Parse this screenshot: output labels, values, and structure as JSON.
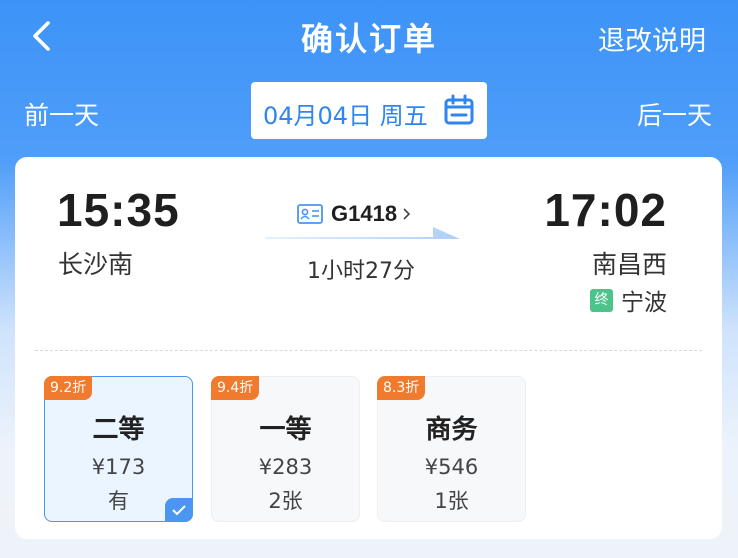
{
  "header": {
    "title": "确认订单",
    "refund_link": "退改说明",
    "back_icon": "chevron-left-icon"
  },
  "date_nav": {
    "prev_day": "前一天",
    "date": "04月04日 周五",
    "next_day": "后一天",
    "calendar_icon": "calendar-icon"
  },
  "trip": {
    "departure_time": "15:35",
    "departure_station": "长沙南",
    "arrival_time": "17:02",
    "arrival_station": "南昌西",
    "train_number": "G1418",
    "duration": "1小时27分",
    "terminal_badge": "终",
    "terminal_station": "宁波"
  },
  "seats": [
    {
      "discount": "9.2折",
      "name": "二等",
      "price": "¥173",
      "availability": "有",
      "selected": true
    },
    {
      "discount": "9.4折",
      "name": "一等",
      "price": "¥283",
      "availability": "2张",
      "selected": false
    },
    {
      "discount": "8.3折",
      "name": "商务",
      "price": "¥546",
      "availability": "1张",
      "selected": false
    }
  ],
  "colors": {
    "primary": "#3d93f8",
    "discount": "#f07a2d",
    "terminal": "#4cc38a",
    "selected_border": "#4a96f0"
  }
}
